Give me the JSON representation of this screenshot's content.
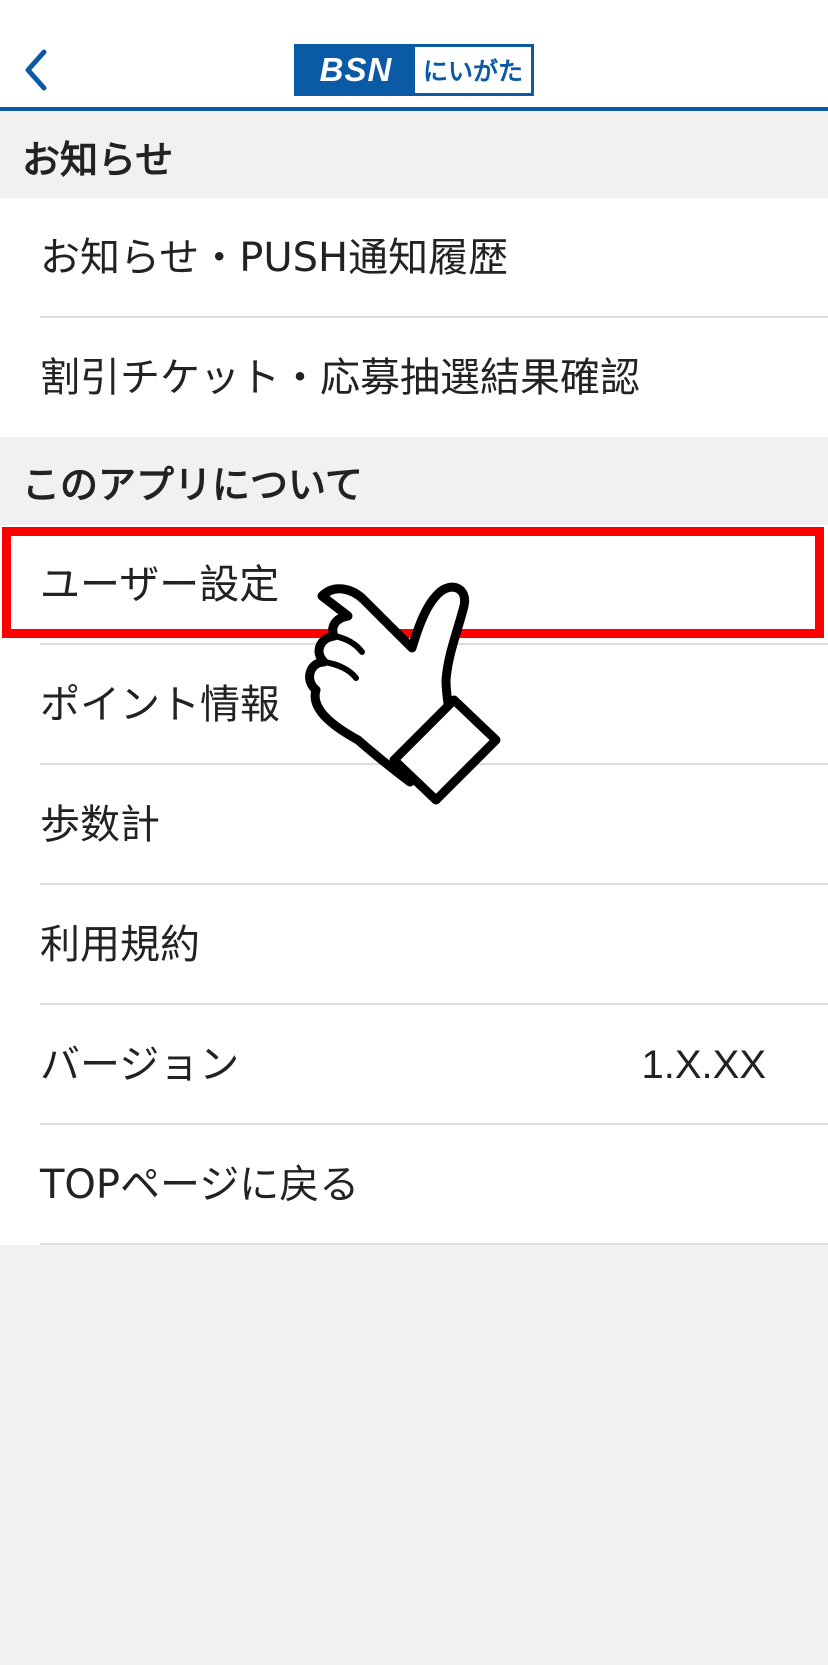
{
  "header": {
    "back_icon": "chevron-left-icon",
    "logo_brand": "BSN",
    "logo_region": "にいがた",
    "accent_color": "#0b5aa5"
  },
  "sections": [
    {
      "title": "お知らせ",
      "items": [
        {
          "label": "お知らせ・PUSH通知履歴"
        },
        {
          "label": "割引チケット・応募抽選結果確認"
        }
      ]
    },
    {
      "title": "このアプリについて",
      "items": [
        {
          "label": "ユーザー設定"
        },
        {
          "label": "ポイント情報"
        },
        {
          "label": "歩数計"
        },
        {
          "label": "利用規約"
        },
        {
          "label": "バージョン",
          "value": "1.X.XX"
        },
        {
          "label": "TOPページに戻る"
        }
      ]
    }
  ],
  "annotation": {
    "highlighted_item": "ユーザー設定",
    "highlight_color": "#ff0000",
    "pointer_icon": "pointing-hand-icon"
  }
}
